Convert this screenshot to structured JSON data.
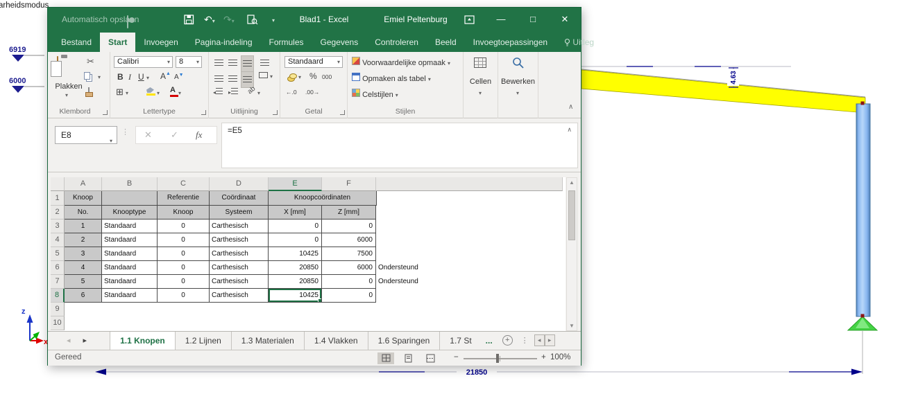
{
  "background": {
    "mode_label": "arheidsmodus",
    "level_upper": "6919",
    "level_lower": "6000",
    "slope_dim": "4.63",
    "width_dim": "21850",
    "axis_z": "z",
    "axis_x": "x",
    "colors": {
      "beam": "#ffff00",
      "column": "#8ec1f7",
      "support": "#3ed13e",
      "dimension": "#00008b"
    }
  },
  "excel": {
    "titlebar": {
      "autosave": "Automatisch opslaan",
      "title": "Blad1 - Excel",
      "user": "Emiel Peltenburg"
    },
    "ribbon_tabs": [
      "Bestand",
      "Start",
      "Invoegen",
      "Pagina-indeling",
      "Formules",
      "Gegevens",
      "Controleren",
      "Beeld",
      "Invoegtoepassingen",
      "Uitleg"
    ],
    "ribbon": {
      "paste": "Plakken",
      "group_clipboard": "Klembord",
      "font_name": "Calibri",
      "font_size": "8",
      "bold": "B",
      "italic": "I",
      "underline": "U",
      "group_font": "Lettertype",
      "group_alignment": "Uitlijning",
      "number_format": "Standaard",
      "percent": "%",
      "thousands": "000",
      "decimals_increase": "←.0",
      "decimals_decrease": ".00→",
      "group_number": "Getal",
      "conditional": "Voorwaardelijke opmaak",
      "format_table": "Opmaken als tabel",
      "cell_styles": "Celstijlen",
      "group_styles": "Stijlen",
      "cells": "Cellen",
      "editing": "Bewerken"
    },
    "formula_bar": {
      "name_box": "E8",
      "fx": "fx",
      "formula": "=E5"
    },
    "grid": {
      "columns": [
        "A",
        "B",
        "C",
        "D",
        "E",
        "F"
      ],
      "rows_visible": [
        "1",
        "2",
        "3",
        "4",
        "5",
        "6",
        "7",
        "8",
        "9",
        "10"
      ],
      "header_row1": {
        "a": "Knoop",
        "c": "Referentie",
        "d": "Coördinaat",
        "ef": "Knoopcoördinaten"
      },
      "header_row2": {
        "a": "No.",
        "b": "Knooptype",
        "c": "Knoop",
        "d": "Systeem",
        "e": "X [mm]",
        "f": "Z [mm]"
      },
      "data": [
        {
          "no": "1",
          "knooptype": "Standaard",
          "ref": "0",
          "systeem": "Carthesisch",
          "x": "0",
          "z": "0",
          "note": ""
        },
        {
          "no": "2",
          "knooptype": "Standaard",
          "ref": "0",
          "systeem": "Carthesisch",
          "x": "0",
          "z": "6000",
          "note": ""
        },
        {
          "no": "3",
          "knooptype": "Standaard",
          "ref": "0",
          "systeem": "Carthesisch",
          "x": "10425",
          "z": "7500",
          "note": ""
        },
        {
          "no": "4",
          "knooptype": "Standaard",
          "ref": "0",
          "systeem": "Carthesisch",
          "x": "20850",
          "z": "6000",
          "note": "Ondersteund"
        },
        {
          "no": "5",
          "knooptype": "Standaard",
          "ref": "0",
          "systeem": "Carthesisch",
          "x": "20850",
          "z": "0",
          "note": "Ondersteund"
        },
        {
          "no": "6",
          "knooptype": "Standaard",
          "ref": "0",
          "systeem": "Carthesisch",
          "x": "10425",
          "z": "0",
          "note": ""
        }
      ],
      "selected": {
        "cell": "E8",
        "row": "8",
        "col": "E"
      }
    },
    "sheet_tabs": [
      "1.1 Knopen",
      "1.2 Lijnen",
      "1.3 Materialen",
      "1.4 Vlakken",
      "1.6 Sparingen",
      "1.7 St"
    ],
    "sheet_tabs_active": "1.1 Knopen",
    "sheet_more": "...",
    "status": {
      "ready": "Gereed",
      "zoom": "100%"
    }
  }
}
